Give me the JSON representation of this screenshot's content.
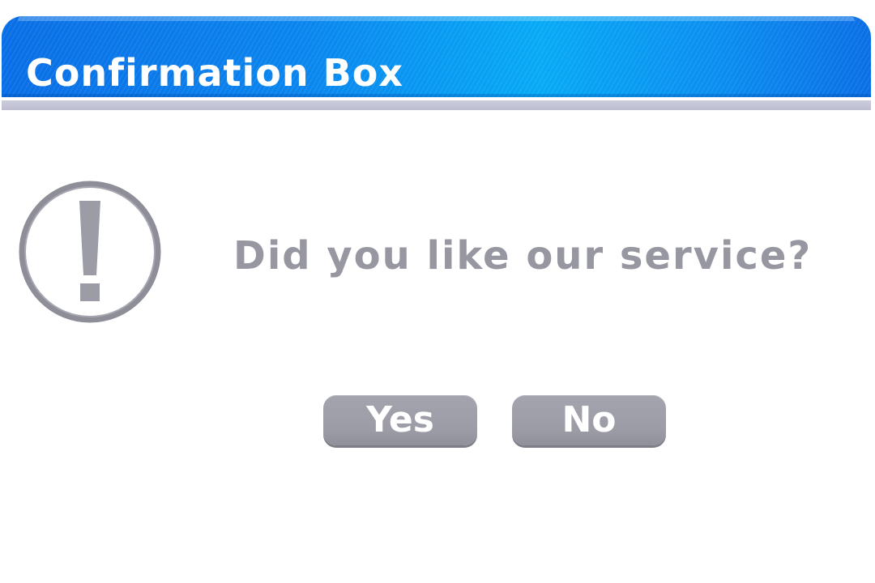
{
  "dialog": {
    "title": "Confirmation Box",
    "message": "Did you like our service?",
    "icon": "exclamation-icon",
    "buttons": {
      "yes_label": "Yes",
      "no_label": "No"
    }
  },
  "colors": {
    "title_bar": "#0a86ee",
    "title_text": "#ffffff",
    "divider": "#bfc0d2",
    "message_text": "#9697a1",
    "icon": "#9b9ca6",
    "button_bg": "#9b9ca6",
    "button_text": "#ffffff",
    "background": "#ffffff"
  }
}
